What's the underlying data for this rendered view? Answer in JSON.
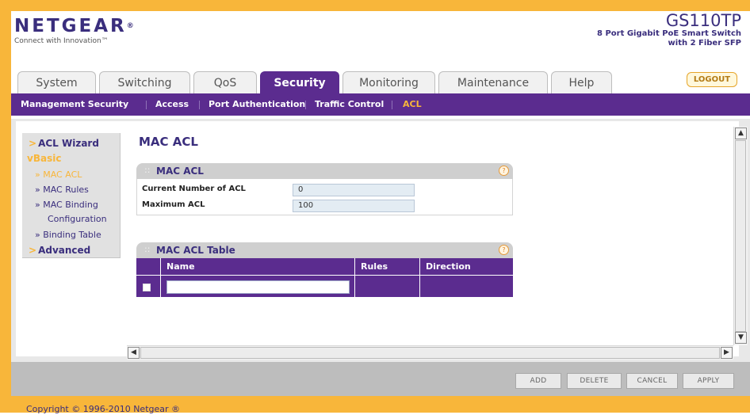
{
  "brand": {
    "logo_text": "NETGEAR",
    "logo_mark": "®",
    "tagline": "Connect with Innovation™",
    "model": "GS110TP",
    "description": "8 Port Gigabit PoE Smart Switch with 2 Fiber SFP"
  },
  "tabs": [
    {
      "label": "System"
    },
    {
      "label": "Switching"
    },
    {
      "label": "QoS"
    },
    {
      "label": "Security",
      "active": true
    },
    {
      "label": "Monitoring"
    },
    {
      "label": "Maintenance"
    },
    {
      "label": "Help"
    }
  ],
  "logout_label": "LOGOUT",
  "subnav": [
    {
      "label": "Management Security"
    },
    {
      "label": "Access"
    },
    {
      "label": "Port Authentication"
    },
    {
      "label": "Traffic Control"
    },
    {
      "label": "ACL",
      "active": true
    }
  ],
  "sidebar": {
    "acl_wizard": "ACL Wizard",
    "basic": "Basic",
    "mac_acl": "MAC ACL",
    "mac_rules": "MAC Rules",
    "mac_binding_1": "MAC Binding",
    "mac_binding_2": "Configuration",
    "binding_table": "Binding Table",
    "advanced": "Advanced",
    "marker_collapsed": ">",
    "marker_expanded": "v",
    "marker_sub": "»"
  },
  "main": {
    "title": "MAC ACL",
    "mac_acl_panel": {
      "title": "MAC ACL",
      "rows": [
        {
          "label": "Current Number of ACL",
          "value": "0"
        },
        {
          "label": "Maximum ACL",
          "value": "100"
        }
      ]
    },
    "table_panel": {
      "title": "MAC ACL Table",
      "columns": [
        "Name",
        "Rules",
        "Direction"
      ],
      "name_input_value": ""
    }
  },
  "buttons": {
    "add": "ADD",
    "delete": "DELETE",
    "cancel": "CANCEL",
    "apply": "APPLY"
  },
  "footer": {
    "copyright": "Copyright © 1996-2010 Netgear ®"
  },
  "colors": {
    "primary_purple": "#5b2c8f",
    "accent_orange": "#f8b63a",
    "brand_navy": "#3a2e7d"
  },
  "icons": {
    "help": "?",
    "scroll_up": "▲",
    "scroll_down": "▼",
    "scroll_left": "◀",
    "scroll_right": "▶"
  }
}
